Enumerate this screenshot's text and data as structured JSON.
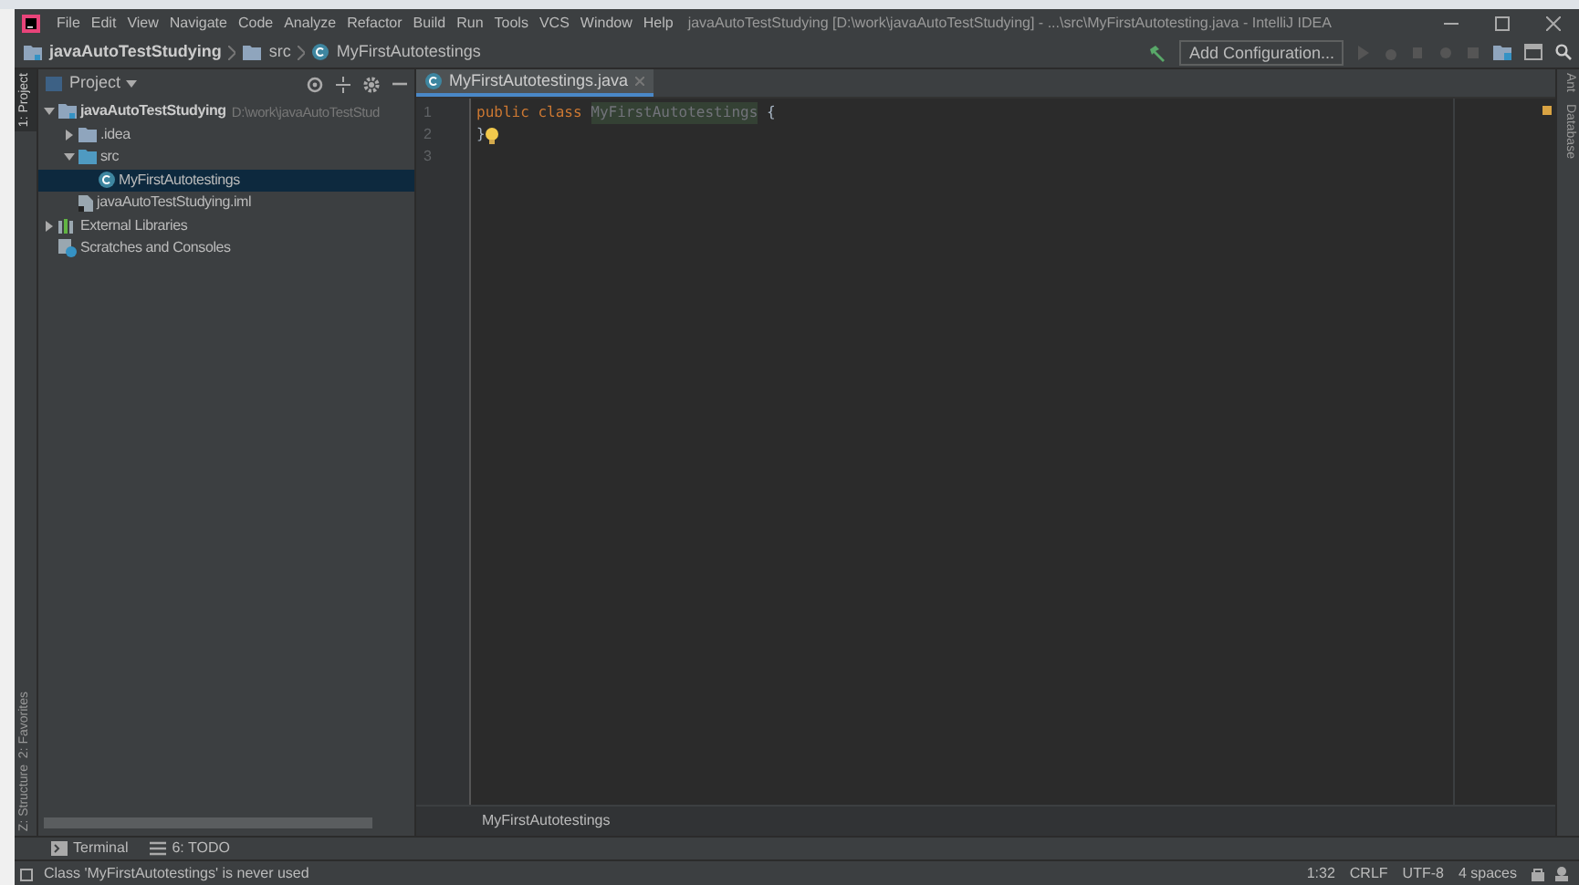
{
  "menu": [
    "File",
    "Edit",
    "View",
    "Navigate",
    "Code",
    "Analyze",
    "Refactor",
    "Build",
    "Run",
    "Tools",
    "VCS",
    "Window",
    "Help"
  ],
  "window": {
    "title": "javaAutoTestStudying [D:\\work\\javaAutoTestStudying] - ...\\src\\MyFirstAutotesting.java - IntelliJ IDEA"
  },
  "breadcrumbs": [
    {
      "label": "javaAutoTestStudying",
      "kind": "project"
    },
    {
      "label": "src",
      "kind": "folder"
    },
    {
      "label": "MyFirstAutotestings",
      "kind": "class"
    }
  ],
  "toolbar": {
    "run_config": "Add Configuration..."
  },
  "left_stripe": [
    {
      "label": "1: Project",
      "selected": true
    },
    {
      "label": "2: Favorites",
      "selected": false
    },
    {
      "label": "Z: Structure",
      "selected": false
    }
  ],
  "right_stripe": [
    "Ant",
    "Database"
  ],
  "project_panel": {
    "title": "Project",
    "tree": [
      {
        "label": "javaAutoTestStudying",
        "hint": "D:\\work\\javaAutoTestStud",
        "kind": "module",
        "expanded": true,
        "selected": false,
        "children": [
          {
            "label": ".idea",
            "kind": "folder",
            "expanded": false,
            "selected": false
          },
          {
            "label": "src",
            "kind": "source",
            "expanded": true,
            "selected": false,
            "children": [
              {
                "label": "MyFirstAutotestings",
                "kind": "class",
                "selected": true
              }
            ]
          },
          {
            "label": "javaAutoTestStudying.iml",
            "kind": "file",
            "selected": false
          }
        ]
      },
      {
        "label": "External Libraries",
        "kind": "library",
        "expanded": false,
        "selected": false
      },
      {
        "label": "Scratches and Consoles",
        "kind": "scratch",
        "selected": false
      }
    ]
  },
  "editor": {
    "tabs": [
      {
        "label": "MyFirstAutotestings.java",
        "selected": true
      }
    ],
    "lines": [
      {
        "number": "1",
        "tokens": [
          {
            "text": "public class ",
            "kind": "keyword"
          },
          {
            "text": "MyFirstAutotestings",
            "kind": "unused"
          },
          {
            "text": " {",
            "kind": "plain"
          }
        ]
      },
      {
        "number": "2",
        "tokens": [
          {
            "text": "}",
            "kind": "plain"
          }
        ],
        "bulb": true
      },
      {
        "number": "3"
      }
    ],
    "breadcrumb": "MyFirstAutotestings"
  },
  "bottom_tabs": [
    {
      "label": "Terminal",
      "kind": "terminal"
    },
    {
      "label": "6: TODO",
      "kind": "todo"
    }
  ],
  "status_bar": {
    "message": "Class 'MyFirstAutotestings' is never used",
    "position": "1:32",
    "line_separator": "CRLF",
    "encoding": "UTF-8",
    "indent": "4 spaces"
  }
}
